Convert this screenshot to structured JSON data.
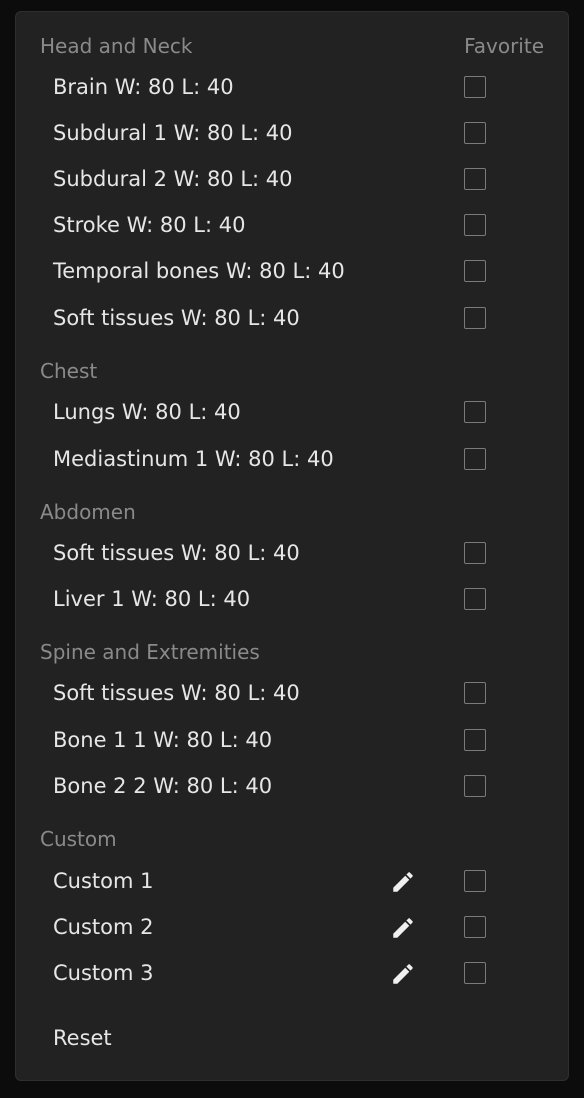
{
  "header": {
    "section_title": "Head and Neck",
    "favorite_label": "Favorite"
  },
  "sections": {
    "chest": "Chest",
    "abdomen": "Abdomen",
    "spine": "Spine and Extremities",
    "custom": "Custom"
  },
  "presets": {
    "brain": "Brain W: 80 L: 40",
    "subdural1": "Subdural 1 W: 80 L: 40",
    "subdural2": "Subdural 2 W: 80 L: 40",
    "stroke": "Stroke W: 80 L: 40",
    "temporal": "Temporal bones W: 80 L: 40",
    "soft_head": "Soft tissues W: 80 L: 40",
    "lungs": "Lungs W: 80 L: 40",
    "mediastinum": "Mediastinum 1 W: 80 L: 40",
    "soft_abdomen": "Soft tissues W: 80 L: 40",
    "liver": "Liver 1 W: 80 L: 40",
    "soft_spine": "Soft tissues W: 80 L: 40",
    "bone1": "Bone 1 1 W: 80 L: 40",
    "bone2": "Bone 2 2 W: 80 L: 40",
    "custom1": "Custom 1",
    "custom2": "Custom 2",
    "custom3": "Custom 3"
  },
  "reset_label": "Reset",
  "icons": {
    "edit": "pencil-icon",
    "favorite": "checkbox-empty"
  },
  "colors": {
    "panel_bg": "#222222",
    "page_bg": "#0c0c0c",
    "text": "#e6e6e6",
    "section_text": "#8a8a8a",
    "checkbox_border": "#7a7a7a"
  }
}
